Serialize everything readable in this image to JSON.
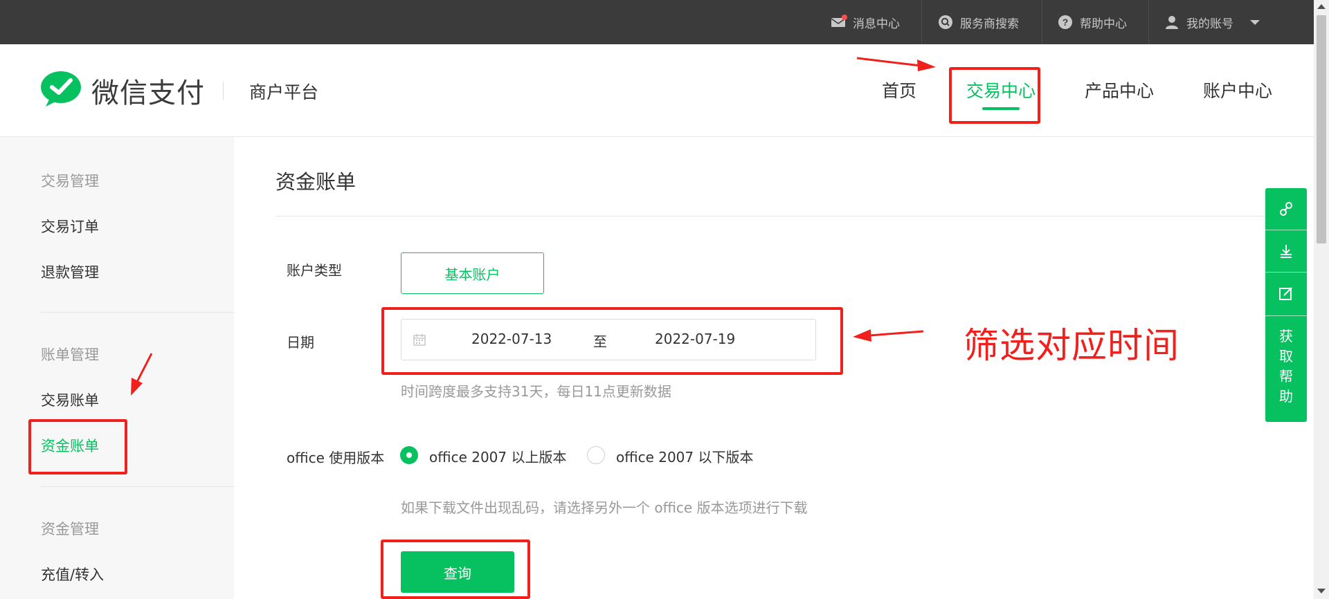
{
  "topbar": {
    "items": [
      {
        "label": "消息中心",
        "icon": "mail-icon"
      },
      {
        "label": "服务商搜索",
        "icon": "search-icon"
      },
      {
        "label": "帮助中心",
        "icon": "help-icon"
      },
      {
        "label": "我的账号",
        "icon": "user-icon"
      }
    ]
  },
  "header": {
    "logo_text": "微信支付",
    "platform": "商户平台",
    "nav": [
      {
        "label": "首页"
      },
      {
        "label": "交易中心",
        "active": true
      },
      {
        "label": "产品中心"
      },
      {
        "label": "账户中心"
      }
    ]
  },
  "sidebar": {
    "groups": [
      {
        "title": "交易管理",
        "items": [
          "交易订单",
          "退款管理"
        ]
      },
      {
        "title": "账单管理",
        "items": [
          "交易账单",
          "资金账单"
        ]
      },
      {
        "title": "资金管理",
        "items": [
          "充值/转入"
        ]
      }
    ],
    "active_item": "资金账单"
  },
  "main": {
    "title": "资金账单",
    "account_type_label": "账户类型",
    "account_type_value": "基本账户",
    "date_label": "日期",
    "date_start": "2022-07-13",
    "date_to": "至",
    "date_end": "2022-07-19",
    "date_hint": "时间跨度最多支持31天，每日11点更新数据",
    "office_label": "office 使用版本",
    "office_options": [
      {
        "label": "office 2007 以上版本",
        "checked": true
      },
      {
        "label": "office 2007 以下版本",
        "checked": false
      }
    ],
    "office_hint": "如果下载文件出现乱码，请选择另外一个 office 版本选项进行下载",
    "query_button": "查询"
  },
  "float_bar": {
    "icons": [
      "link-icon",
      "download-icon",
      "edit-icon"
    ],
    "help_text": [
      "获",
      "取",
      "帮",
      "助"
    ]
  },
  "annotation": {
    "text": "筛选对应时间"
  },
  "colors": {
    "brand_green": "#07c160",
    "topbar_bg": "#3b3b3b",
    "annotation_red": "#f0201c"
  }
}
